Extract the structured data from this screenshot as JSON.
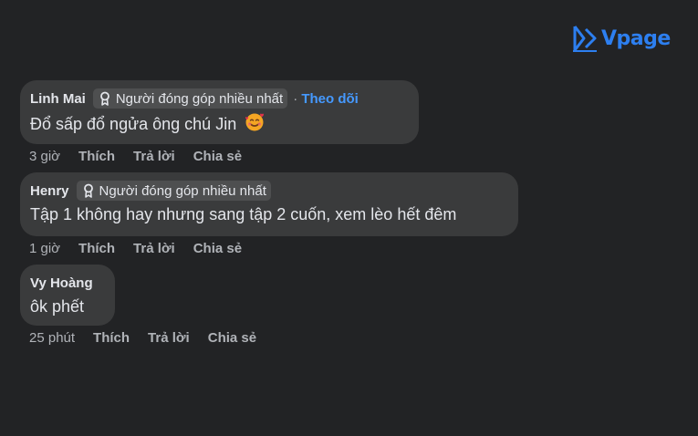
{
  "brand": {
    "name": "Vpage",
    "color": "#2d7ff0"
  },
  "comments": [
    {
      "author": "Linh Mai",
      "badge": "Người đóng góp nhiều nhất",
      "follow_sep": "·",
      "follow": "Theo dõi",
      "text": "Đổ sấp đổ ngửa ông chú Jin",
      "emoji": "smiling-face-with-hearts",
      "time": "3 giờ",
      "like": "Thích",
      "reply": "Trả lời",
      "share": "Chia sẻ"
    },
    {
      "author": "Henry",
      "badge": "Người đóng góp nhiều nhất",
      "text": "Tập 1 không hay nhưng sang tập 2 cuốn, xem lèo hết đêm",
      "time": "1 giờ",
      "like": "Thích",
      "reply": "Trả lời",
      "share": "Chia sẻ"
    },
    {
      "author": "Vy Hoàng",
      "text": "ôk phết",
      "time": "25 phút",
      "like": "Thích",
      "reply": "Trả lời",
      "share": "Chia sẻ"
    }
  ],
  "colors": {
    "background": "#222325",
    "bubble": "#3a3b3c",
    "badge": "#4e4f50",
    "link": "#4599ff",
    "meta_text": "#b0b3b8"
  }
}
